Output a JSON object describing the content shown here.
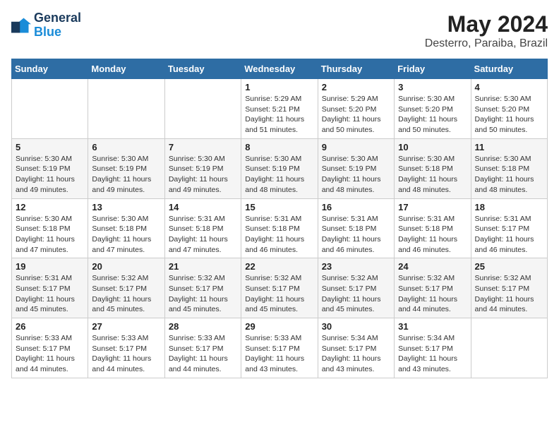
{
  "header": {
    "logo_line1": "General",
    "logo_line2": "Blue",
    "month_year": "May 2024",
    "location": "Desterro, Paraiba, Brazil"
  },
  "days_of_week": [
    "Sunday",
    "Monday",
    "Tuesday",
    "Wednesday",
    "Thursday",
    "Friday",
    "Saturday"
  ],
  "weeks": [
    [
      {
        "day": "",
        "sunrise": "",
        "sunset": "",
        "daylight": ""
      },
      {
        "day": "",
        "sunrise": "",
        "sunset": "",
        "daylight": ""
      },
      {
        "day": "",
        "sunrise": "",
        "sunset": "",
        "daylight": ""
      },
      {
        "day": "1",
        "sunrise": "Sunrise: 5:29 AM",
        "sunset": "Sunset: 5:21 PM",
        "daylight": "Daylight: 11 hours and 51 minutes."
      },
      {
        "day": "2",
        "sunrise": "Sunrise: 5:29 AM",
        "sunset": "Sunset: 5:20 PM",
        "daylight": "Daylight: 11 hours and 50 minutes."
      },
      {
        "day": "3",
        "sunrise": "Sunrise: 5:30 AM",
        "sunset": "Sunset: 5:20 PM",
        "daylight": "Daylight: 11 hours and 50 minutes."
      },
      {
        "day": "4",
        "sunrise": "Sunrise: 5:30 AM",
        "sunset": "Sunset: 5:20 PM",
        "daylight": "Daylight: 11 hours and 50 minutes."
      }
    ],
    [
      {
        "day": "5",
        "sunrise": "Sunrise: 5:30 AM",
        "sunset": "Sunset: 5:19 PM",
        "daylight": "Daylight: 11 hours and 49 minutes."
      },
      {
        "day": "6",
        "sunrise": "Sunrise: 5:30 AM",
        "sunset": "Sunset: 5:19 PM",
        "daylight": "Daylight: 11 hours and 49 minutes."
      },
      {
        "day": "7",
        "sunrise": "Sunrise: 5:30 AM",
        "sunset": "Sunset: 5:19 PM",
        "daylight": "Daylight: 11 hours and 49 minutes."
      },
      {
        "day": "8",
        "sunrise": "Sunrise: 5:30 AM",
        "sunset": "Sunset: 5:19 PM",
        "daylight": "Daylight: 11 hours and 48 minutes."
      },
      {
        "day": "9",
        "sunrise": "Sunrise: 5:30 AM",
        "sunset": "Sunset: 5:19 PM",
        "daylight": "Daylight: 11 hours and 48 minutes."
      },
      {
        "day": "10",
        "sunrise": "Sunrise: 5:30 AM",
        "sunset": "Sunset: 5:18 PM",
        "daylight": "Daylight: 11 hours and 48 minutes."
      },
      {
        "day": "11",
        "sunrise": "Sunrise: 5:30 AM",
        "sunset": "Sunset: 5:18 PM",
        "daylight": "Daylight: 11 hours and 48 minutes."
      }
    ],
    [
      {
        "day": "12",
        "sunrise": "Sunrise: 5:30 AM",
        "sunset": "Sunset: 5:18 PM",
        "daylight": "Daylight: 11 hours and 47 minutes."
      },
      {
        "day": "13",
        "sunrise": "Sunrise: 5:30 AM",
        "sunset": "Sunset: 5:18 PM",
        "daylight": "Daylight: 11 hours and 47 minutes."
      },
      {
        "day": "14",
        "sunrise": "Sunrise: 5:31 AM",
        "sunset": "Sunset: 5:18 PM",
        "daylight": "Daylight: 11 hours and 47 minutes."
      },
      {
        "day": "15",
        "sunrise": "Sunrise: 5:31 AM",
        "sunset": "Sunset: 5:18 PM",
        "daylight": "Daylight: 11 hours and 46 minutes."
      },
      {
        "day": "16",
        "sunrise": "Sunrise: 5:31 AM",
        "sunset": "Sunset: 5:18 PM",
        "daylight": "Daylight: 11 hours and 46 minutes."
      },
      {
        "day": "17",
        "sunrise": "Sunrise: 5:31 AM",
        "sunset": "Sunset: 5:18 PM",
        "daylight": "Daylight: 11 hours and 46 minutes."
      },
      {
        "day": "18",
        "sunrise": "Sunrise: 5:31 AM",
        "sunset": "Sunset: 5:17 PM",
        "daylight": "Daylight: 11 hours and 46 minutes."
      }
    ],
    [
      {
        "day": "19",
        "sunrise": "Sunrise: 5:31 AM",
        "sunset": "Sunset: 5:17 PM",
        "daylight": "Daylight: 11 hours and 45 minutes."
      },
      {
        "day": "20",
        "sunrise": "Sunrise: 5:32 AM",
        "sunset": "Sunset: 5:17 PM",
        "daylight": "Daylight: 11 hours and 45 minutes."
      },
      {
        "day": "21",
        "sunrise": "Sunrise: 5:32 AM",
        "sunset": "Sunset: 5:17 PM",
        "daylight": "Daylight: 11 hours and 45 minutes."
      },
      {
        "day": "22",
        "sunrise": "Sunrise: 5:32 AM",
        "sunset": "Sunset: 5:17 PM",
        "daylight": "Daylight: 11 hours and 45 minutes."
      },
      {
        "day": "23",
        "sunrise": "Sunrise: 5:32 AM",
        "sunset": "Sunset: 5:17 PM",
        "daylight": "Daylight: 11 hours and 45 minutes."
      },
      {
        "day": "24",
        "sunrise": "Sunrise: 5:32 AM",
        "sunset": "Sunset: 5:17 PM",
        "daylight": "Daylight: 11 hours and 44 minutes."
      },
      {
        "day": "25",
        "sunrise": "Sunrise: 5:32 AM",
        "sunset": "Sunset: 5:17 PM",
        "daylight": "Daylight: 11 hours and 44 minutes."
      }
    ],
    [
      {
        "day": "26",
        "sunrise": "Sunrise: 5:33 AM",
        "sunset": "Sunset: 5:17 PM",
        "daylight": "Daylight: 11 hours and 44 minutes."
      },
      {
        "day": "27",
        "sunrise": "Sunrise: 5:33 AM",
        "sunset": "Sunset: 5:17 PM",
        "daylight": "Daylight: 11 hours and 44 minutes."
      },
      {
        "day": "28",
        "sunrise": "Sunrise: 5:33 AM",
        "sunset": "Sunset: 5:17 PM",
        "daylight": "Daylight: 11 hours and 44 minutes."
      },
      {
        "day": "29",
        "sunrise": "Sunrise: 5:33 AM",
        "sunset": "Sunset: 5:17 PM",
        "daylight": "Daylight: 11 hours and 43 minutes."
      },
      {
        "day": "30",
        "sunrise": "Sunrise: 5:34 AM",
        "sunset": "Sunset: 5:17 PM",
        "daylight": "Daylight: 11 hours and 43 minutes."
      },
      {
        "day": "31",
        "sunrise": "Sunrise: 5:34 AM",
        "sunset": "Sunset: 5:17 PM",
        "daylight": "Daylight: 11 hours and 43 minutes."
      },
      {
        "day": "",
        "sunrise": "",
        "sunset": "",
        "daylight": ""
      }
    ]
  ]
}
